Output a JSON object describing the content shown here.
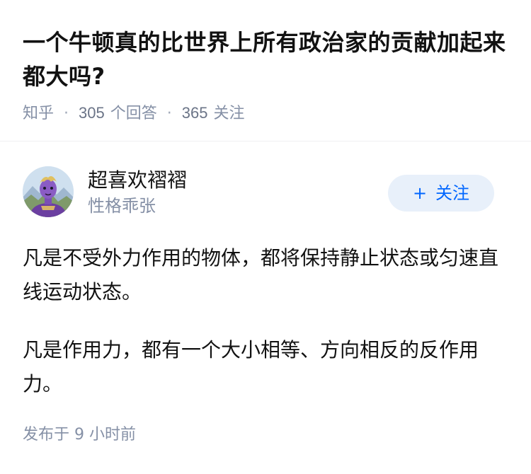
{
  "question": {
    "title": "一个牛顿真的比世界上所有政治家的贡献加起来都大吗?",
    "source": "知乎",
    "answer_count": "305",
    "answer_label": "个回答",
    "follower_count": "365",
    "follower_label": "关注",
    "separator": "·"
  },
  "answer": {
    "author": {
      "name": "超喜欢褶褶",
      "bio": "性格乖张",
      "avatar_icon": "avatar-icon"
    },
    "follow_button": {
      "icon": "+",
      "label": "关注"
    },
    "paragraphs": [
      "凡是不受外力作用的物体，都将保持静止状态或匀速直线运动状态。",
      "凡是作用力，都有一个大小相等、方向相反的反作用力。"
    ],
    "publish_prefix": "发布于",
    "publish_time": "9 小时前"
  },
  "colors": {
    "accent": "#0066ff",
    "follow_bg": "#e8f0fa",
    "muted": "#8590a6",
    "text": "#121212"
  }
}
